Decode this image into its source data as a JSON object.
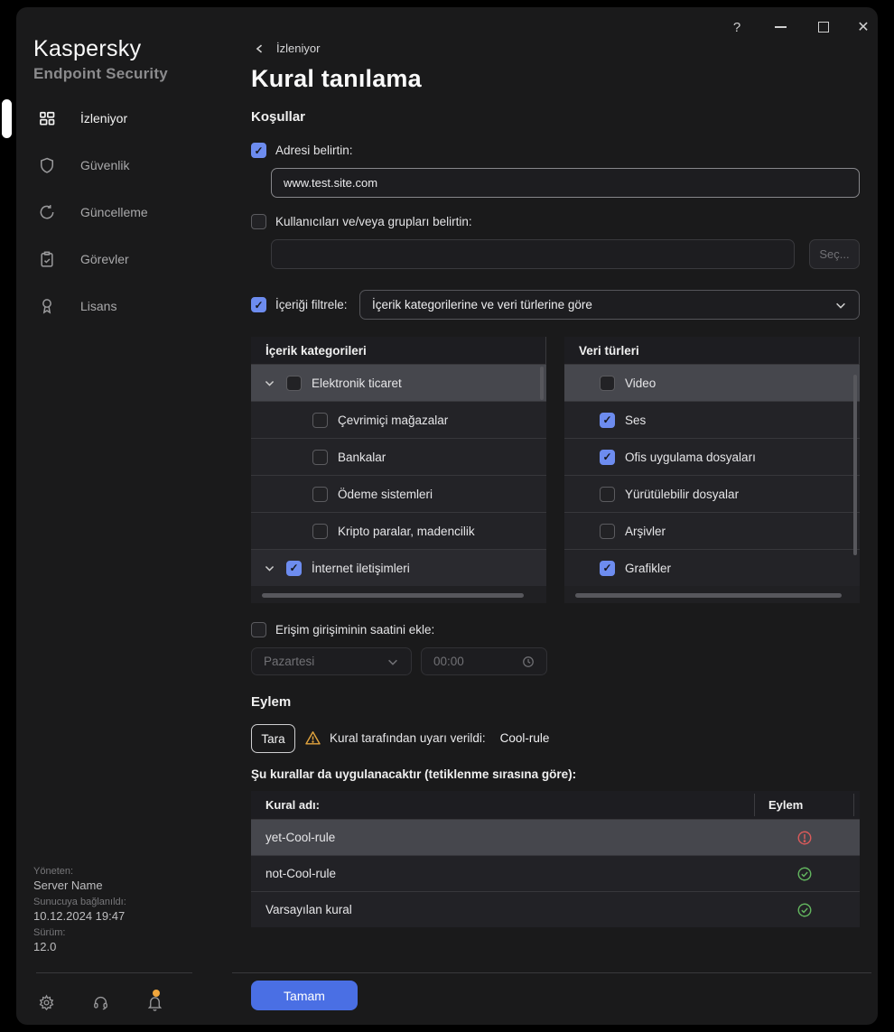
{
  "colors": {
    "window_bg": "#1a1a1b",
    "accent_blue": "#4a6fe4",
    "checkbox_blue": "#6d8cef",
    "warning_orange": "#e2a43e",
    "error_red": "#d95a5a",
    "success_green": "#62b45e"
  },
  "titlebar": {
    "help_label": "?"
  },
  "brand": {
    "name": "Kaspersky",
    "product": "Endpoint Security"
  },
  "sidebar": {
    "items": [
      {
        "label": "İzleniyor",
        "icon": "dashboard-icon",
        "active": true
      },
      {
        "label": "Güvenlik",
        "icon": "shield-icon",
        "active": false
      },
      {
        "label": "Güncelleme",
        "icon": "refresh-icon",
        "active": false
      },
      {
        "label": "Görevler",
        "icon": "tasks-icon",
        "active": false
      },
      {
        "label": "Lisans",
        "icon": "license-icon",
        "active": false
      }
    ],
    "footer": {
      "managed_label": "Yöneten:",
      "server_name": "Server Name",
      "connected_label": "Sunucuya bağlanıldı:",
      "connected_at": "10.12.2024 19:47",
      "version_label": "Sürüm:",
      "version": "12.0"
    }
  },
  "main": {
    "breadcrumb": "İzleniyor",
    "title": "Kural tanılama",
    "conditions_heading": "Koşullar",
    "address": {
      "label": "Adresi belirtin:",
      "checked": true,
      "value": "www.test.site.com"
    },
    "users": {
      "label": "Kullanıcıları ve/veya grupları belirtin:",
      "checked": false,
      "value": "",
      "select_button": "Seç..."
    },
    "filter": {
      "label": "İçeriği filtrele:",
      "checked": true,
      "selected_option": "İçerik kategorilerine ve veri türlerine göre"
    },
    "categories_panel": {
      "title": "İçerik kategorileri",
      "rows": [
        {
          "label": "Elektronik ticaret",
          "checked": false,
          "expandable": true,
          "selected": true
        },
        {
          "label": "Çevrimiçi mağazalar",
          "checked": false,
          "child": true
        },
        {
          "label": "Bankalar",
          "checked": false,
          "child": true
        },
        {
          "label": "Ödeme sistemleri",
          "checked": false,
          "child": true
        },
        {
          "label": "Kripto paralar, madencilik",
          "checked": false,
          "child": true
        },
        {
          "label": "İnternet iletişimleri",
          "checked": true,
          "expandable": true
        }
      ]
    },
    "datatypes_panel": {
      "title": "Veri türleri",
      "rows": [
        {
          "label": "Video",
          "checked": false,
          "selected": true
        },
        {
          "label": "Ses",
          "checked": true
        },
        {
          "label": "Ofis uygulama dosyaları",
          "checked": true
        },
        {
          "label": "Yürütülebilir dosyalar",
          "checked": false
        },
        {
          "label": "Arşivler",
          "checked": false
        },
        {
          "label": "Grafikler",
          "checked": true
        }
      ]
    },
    "time": {
      "label": "Erişim girişiminin saatini ekle:",
      "checked": false,
      "day": "Pazartesi",
      "time": "00:00"
    },
    "action_heading": "Eylem",
    "action": {
      "scan_button": "Tara",
      "warning_text": "Kural tarafından uyarı verildi:",
      "triggered_rule": "Cool-rule"
    },
    "rules_table": {
      "caption": "Şu kurallar da uygulanacaktır (tetiklenme sırasına göre):",
      "columns": {
        "name": "Kural adı:",
        "action": "Eylem"
      },
      "rows": [
        {
          "name": "yet-Cool-rule",
          "status": "warning",
          "selected": true
        },
        {
          "name": "not-Cool-rule",
          "status": "ok",
          "selected": false
        },
        {
          "name": "Varsayılan kural",
          "status": "ok",
          "selected": false
        }
      ]
    }
  },
  "footer": {
    "ok_button": "Tamam"
  }
}
